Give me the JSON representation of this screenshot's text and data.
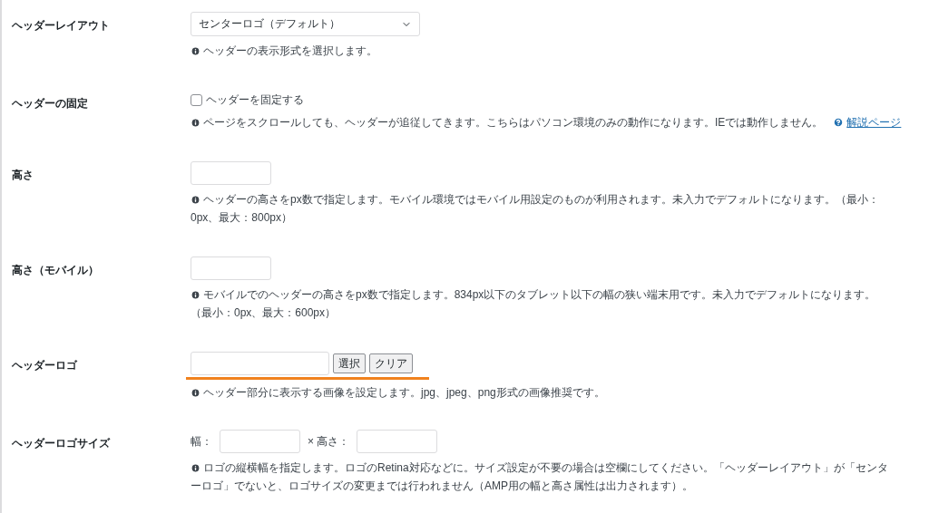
{
  "settings": [
    {
      "kind": "select",
      "label": "ヘッダーレイアウト",
      "value": "センターロゴ（デフォルト）",
      "help": [
        "ヘッダーの表示形式を選択します。"
      ]
    },
    {
      "kind": "checkbox",
      "label": "ヘッダーの固定",
      "checkbox_label": "ヘッダーを固定する",
      "checked": false,
      "help": [
        "ページをスクロールしても、ヘッダーが追従してきます。こちらはパソコン環境のみの動作になります。IEでは動作しません。"
      ],
      "link": "解説ページ"
    },
    {
      "kind": "text",
      "label": "高さ",
      "help": [
        "ヘッダーの高さをpx数で指定します。モバイル環境ではモバイル用設定のものが利用されます。未入力でデフォルトになります。（最小：",
        "0px、最大：800px）"
      ]
    },
    {
      "kind": "text",
      "label": "高さ（モバイル）",
      "help": [
        "モバイルでのヘッダーの高さをpx数で指定します。834px以下のタブレット以下の幅の狭い端末用です。未入力でデフォルトになります。",
        "（最小：0px、最大：600px）"
      ]
    },
    {
      "kind": "image",
      "label": "ヘッダーロゴ",
      "buttons": [
        "選択",
        "クリア"
      ],
      "highlighted": true,
      "help": [
        "ヘッダー部分に表示する画像を設定します。jpg、jpeg、png形式の画像推奨です。"
      ]
    },
    {
      "kind": "size",
      "label": "ヘッダーロゴサイズ",
      "width_label": "幅：",
      "height_label": "× 高さ：",
      "help": [
        "ロゴの縦横幅を指定します。ロゴのRetina対応などに。サイズ設定が不要の場合は空欄にしてください。「ヘッダーレイアウト」が「センタ",
        "ーロゴ」でないと、ロゴサイズの変更までは行われません（AMP用の幅と高さ属性は出力されます）。"
      ]
    }
  ]
}
